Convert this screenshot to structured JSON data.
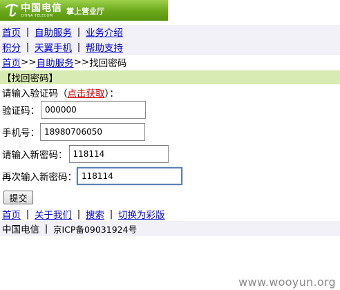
{
  "header": {
    "logo_cn": "中国电信",
    "logo_en": "CHINA TELECOM",
    "app_title": "掌上营业厅",
    "brand_color": "#6aa81a",
    "logo_icon": "china-telecom-logo-icon"
  },
  "nav": {
    "row1": [
      "首页",
      "自助服务",
      "业务介绍"
    ],
    "row2": [
      "积分",
      "天翼手机",
      "帮助支持"
    ],
    "separator": "|"
  },
  "breadcrumb": {
    "home": "首页",
    "sep1": ">>",
    "self_service": "自助服务",
    "sep2": ">>",
    "current": "找回密码"
  },
  "section": {
    "title": "【找回密码】"
  },
  "prompt": {
    "before": "请输入验证码（",
    "link": "点击获取",
    "after": "）："
  },
  "form": {
    "code_label": "验证码：",
    "code_value": "000000",
    "phone_label": "手机号：",
    "phone_value": "18980706050",
    "new_pwd_label": "请输入新密码：",
    "new_pwd_value": "118114",
    "confirm_pwd_label": "再次输入新密码：",
    "confirm_pwd_value": "118114",
    "submit_label": "提交"
  },
  "footer": {
    "links": [
      "首页",
      "关于我们",
      "搜索",
      "切换为彩版"
    ],
    "company": "中国电信",
    "icp": "京ICP备09031924号"
  },
  "watermark": "www.wooyun.org"
}
